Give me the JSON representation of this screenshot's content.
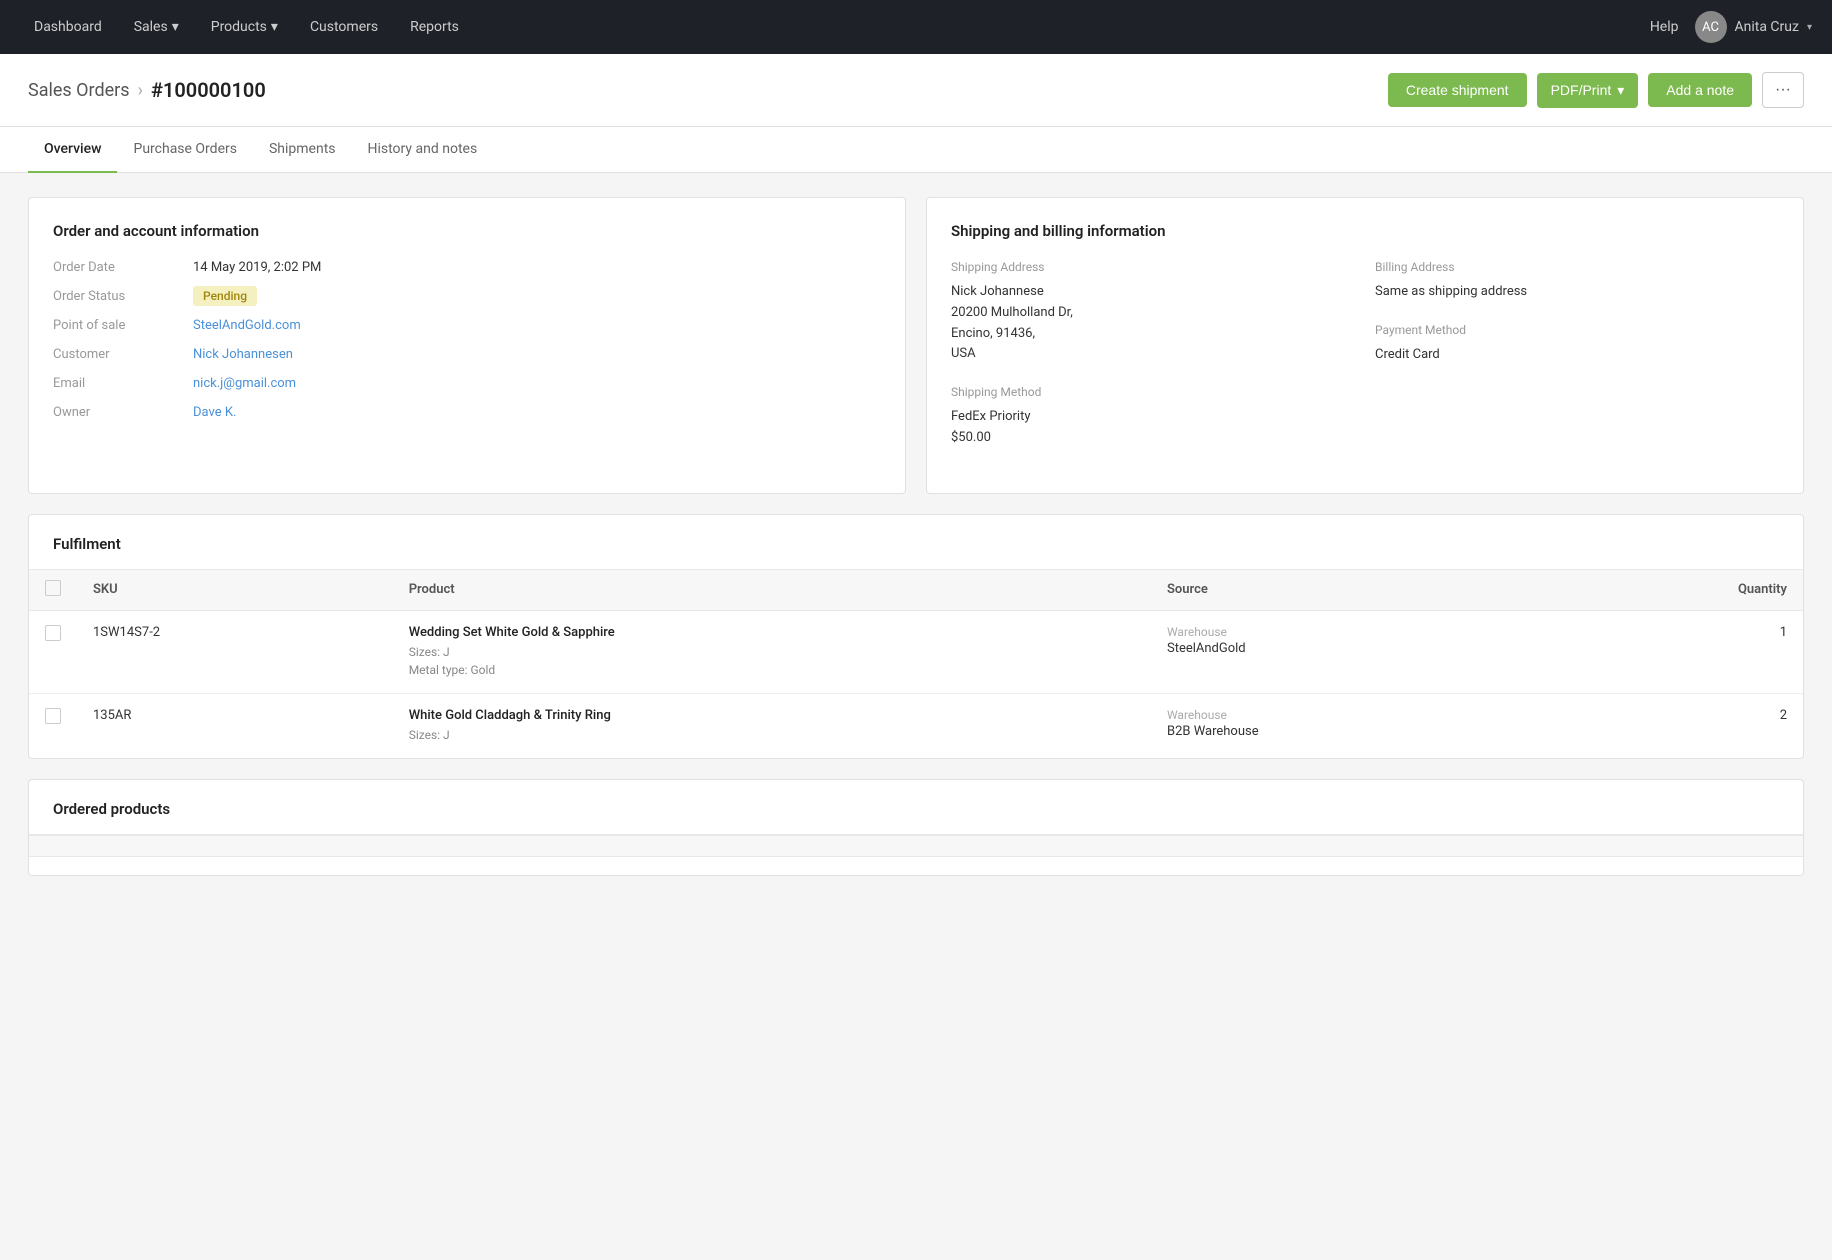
{
  "topnav": {
    "items": [
      {
        "label": "Dashboard",
        "active": false
      },
      {
        "label": "Sales",
        "hasDropdown": true,
        "active": false
      },
      {
        "label": "Products",
        "hasDropdown": true,
        "active": false
      },
      {
        "label": "Customers",
        "active": false
      },
      {
        "label": "Reports",
        "active": false
      }
    ],
    "help_label": "Help",
    "user_name": "Anita Cruz",
    "chevron": "▾"
  },
  "breadcrumb": {
    "parent": "Sales Orders",
    "separator": "›",
    "current": "#100000100"
  },
  "buttons": {
    "create_shipment": "Create shipment",
    "pdf_print": "PDF/Print",
    "add_note": "Add a note",
    "more": "···"
  },
  "tabs": [
    {
      "label": "Overview",
      "active": true
    },
    {
      "label": "Purchase Orders",
      "active": false
    },
    {
      "label": "Shipments",
      "active": false
    },
    {
      "label": "History and notes",
      "active": false
    }
  ],
  "order_info": {
    "title": "Order and account information",
    "fields": [
      {
        "label": "Order Date",
        "value": "14 May 2019, 2:02 PM",
        "type": "text"
      },
      {
        "label": "Order Status",
        "value": "Pending",
        "type": "badge"
      },
      {
        "label": "Point of sale",
        "value": "SteelAndGold.com",
        "type": "link"
      },
      {
        "label": "Customer",
        "value": "Nick Johannesen",
        "type": "link"
      },
      {
        "label": "Email",
        "value": "nick.j@gmail.com",
        "type": "link"
      },
      {
        "label": "Owner",
        "value": "Dave K.",
        "type": "link"
      }
    ]
  },
  "shipping_info": {
    "title": "Shipping and billing information",
    "shipping_address_label": "Shipping Address",
    "shipping_address": "Nick Johannese\n20200 Mulholland Dr,\nEncino, 91436,\nUSA",
    "billing_address_label": "Billing Address",
    "billing_address": "Same as shipping address",
    "payment_method_label": "Payment Method",
    "payment_method": "Credit Card",
    "shipping_method_label": "Shipping Method",
    "shipping_method": "FedEx Priority",
    "shipping_cost": "$50.00"
  },
  "fulfilment": {
    "title": "Fulfilment",
    "columns": [
      {
        "label": "SKU"
      },
      {
        "label": "Product"
      },
      {
        "label": "Source"
      },
      {
        "label": "Quantity",
        "align": "right"
      }
    ],
    "rows": [
      {
        "sku": "1SW14S7-2",
        "product_name": "Wedding Set White Gold & Sapphire",
        "product_details": [
          "Sizes: J",
          "Metal type: Gold"
        ],
        "source_label": "Warehouse",
        "source_value": "SteelAndGold",
        "quantity": "1"
      },
      {
        "sku": "135AR",
        "product_name": "White Gold Claddagh & Trinity Ring",
        "product_details": [
          "Sizes: J"
        ],
        "source_label": "Warehouse",
        "source_value": "B2B Warehouse",
        "quantity": "2"
      }
    ]
  },
  "ordered_products": {
    "title": "Ordered products"
  }
}
